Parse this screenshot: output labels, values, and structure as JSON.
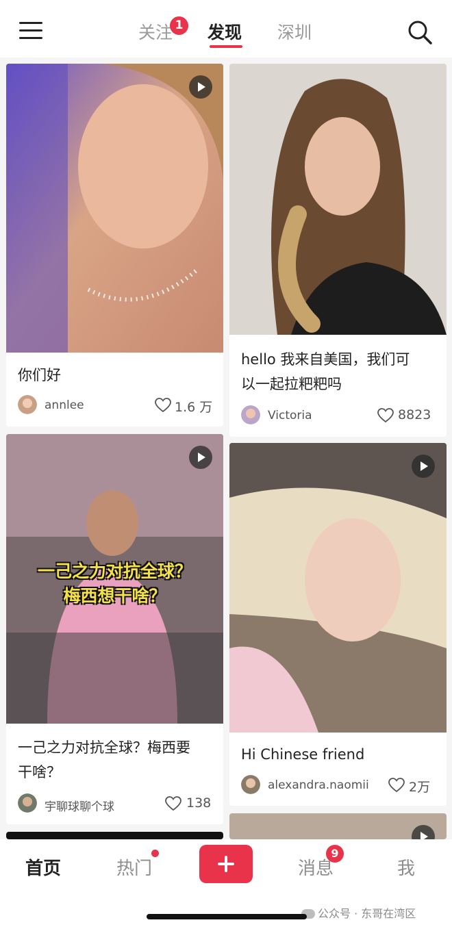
{
  "header": {
    "tabs": [
      {
        "label": "关注",
        "badge": "1"
      },
      {
        "label": "发现",
        "active": true
      },
      {
        "label": "深圳"
      }
    ]
  },
  "feed": [
    {
      "title": "你们好",
      "author": "annlee",
      "likes": "1.6 万",
      "video": true
    },
    {
      "title_line1": "hello 我来自美国，我们可",
      "title_line2": "以一起拉粑粑吗",
      "author": "Victoria",
      "likes": "8823",
      "video": false
    },
    {
      "title_line1": "一己之力对抗全球？梅西要",
      "title_line2": "干啥？",
      "author": "宇聊球聊个球",
      "likes": "138",
      "video": true,
      "caption_line1": "一己之力对抗全球？",
      "caption_line2": "梅西想干啥？"
    },
    {
      "title": "Hi Chinese friend",
      "author": "alexandra.naomii",
      "likes": "2万",
      "video": true
    }
  ],
  "bottom_nav": {
    "home": "首页",
    "hot": "热门",
    "messages": "消息",
    "messages_badge": "9",
    "me": "我"
  },
  "watermark": "公众号 · 东哥在湾区",
  "colors": {
    "accent": "#e8334a",
    "background": "#f5f5f5"
  }
}
